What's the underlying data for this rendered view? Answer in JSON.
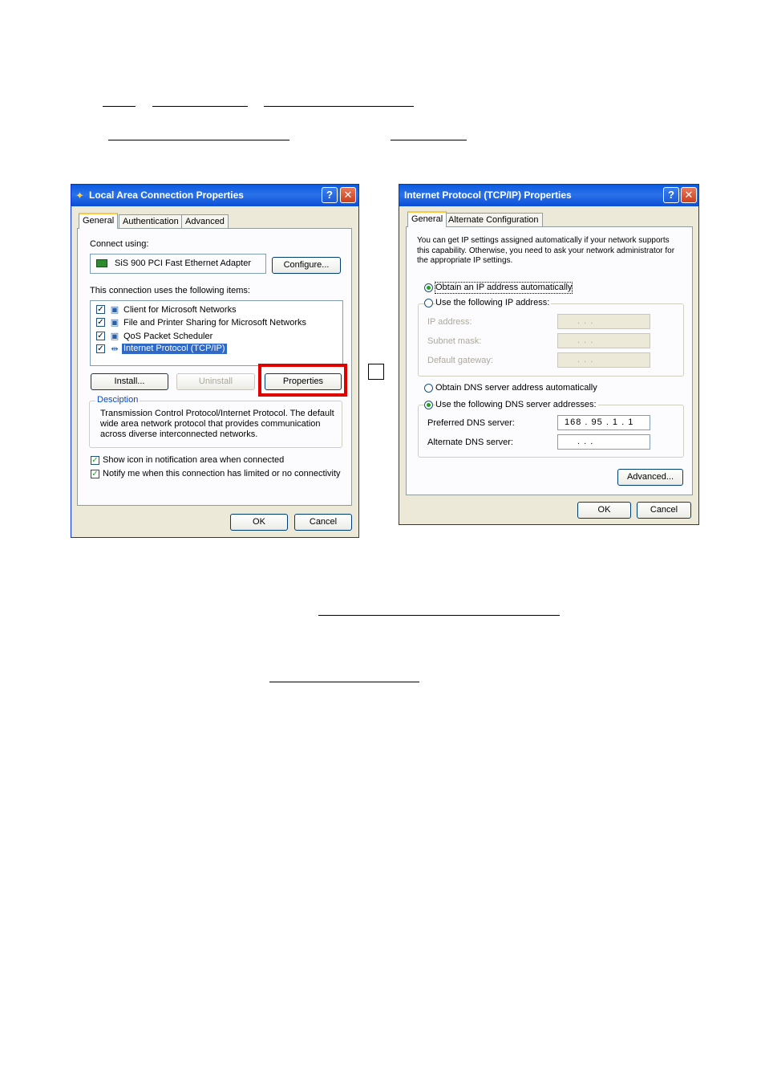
{
  "doc": {
    "arrow_box": ""
  },
  "lan_dialog": {
    "title": "Local Area Connection Properties",
    "help_glyph": "?",
    "close_glyph": "✕",
    "tabs": [
      "General",
      "Authentication",
      "Advanced"
    ],
    "connect_using_label": "Connect using:",
    "adapter_name": "SiS 900 PCI Fast Ethernet Adapter",
    "configure_button": "Configure...",
    "items_label": "This connection uses the following items:",
    "items": [
      {
        "label": "Client for Microsoft Networks",
        "checked": true,
        "icon": "network-client-icon"
      },
      {
        "label": "File and Printer Sharing for Microsoft Networks",
        "checked": true,
        "icon": "file-printer-sharing-icon"
      },
      {
        "label": "QoS Packet Scheduler",
        "checked": true,
        "icon": "qos-scheduler-icon"
      },
      {
        "label": "Internet Protocol (TCP/IP)",
        "checked": true,
        "icon": "protocol-icon",
        "selected": true
      }
    ],
    "install_button": "Install...",
    "uninstall_button": "Uninstall",
    "properties_button": "Properties",
    "description_legend": "Desciption",
    "description_text": "Transmission Control Protocol/Internet Protocol. The default wide area network protocol that provides communication across diverse interconnected networks.",
    "show_icon_label": "Show icon in notification area when connected",
    "notify_label": "Notify me when this connection has limited or no connectivity",
    "ok_button": "OK",
    "cancel_button": "Cancel",
    "highlight_color": "#e00000"
  },
  "tcpip_dialog": {
    "title": "Internet Protocol (TCP/IP) Properties",
    "help_glyph": "?",
    "close_glyph": "✕",
    "tabs": [
      "General",
      "Alternate Configuration"
    ],
    "intro_text": "You can get IP settings assigned automatically if your network supports this capability. Otherwise, you need to ask your network administrator for the appropriate IP settings.",
    "obtain_ip_auto": "Obtain an IP address automatically",
    "use_following_ip": "Use the following IP address:",
    "ip_address_label": "IP address:",
    "subnet_label": "Subnet mask:",
    "gateway_label": "Default gateway:",
    "empty_ip": ".   .   .",
    "obtain_dns_auto": "Obtain DNS server address automatically",
    "use_following_dns": "Use the following DNS server addresses:",
    "preferred_dns_label": "Preferred DNS server:",
    "preferred_dns_value": "168 . 95 .  1  .  1",
    "alternate_dns_label": "Alternate DNS server:",
    "alternate_dns_value": ".   .   .",
    "advanced_button": "Advanced...",
    "ok_button": "OK",
    "cancel_button": "Cancel"
  }
}
